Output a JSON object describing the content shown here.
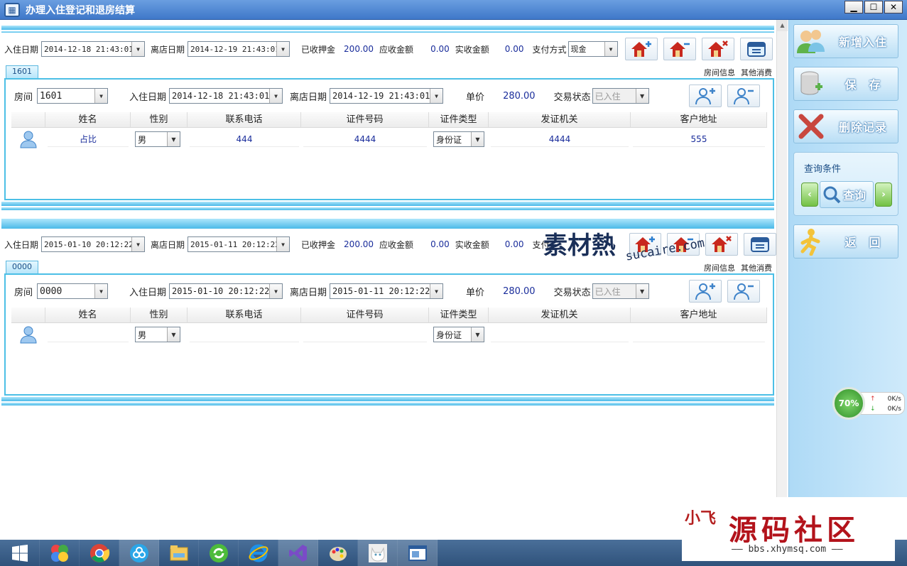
{
  "window": {
    "title": "办理入住登记和退房结算",
    "app_icon": "calendar-app-icon",
    "controls": {
      "minimize": "▁",
      "maximize": "☐",
      "close": "✕"
    }
  },
  "records": [
    {
      "top": {
        "checkin_label": "入住日期",
        "checkin_value": "2014-12-18 21:43:01",
        "checkout_label": "离店日期",
        "checkout_value": "2014-12-19 21:43:01",
        "deposit_label": "已收押金",
        "deposit_value": "200.00",
        "due_label": "应收金额",
        "due_value": "0.00",
        "paid_label": "实收金额",
        "paid_value": "0.00",
        "pay_label": "支付方式",
        "pay_value": "现金"
      },
      "tab": "1601",
      "tab_links": [
        "房间信息",
        "其他消费"
      ],
      "room": {
        "room_label": "房间",
        "room_value": "1601",
        "checkin_label": "入住日期",
        "checkin_value": "2014-12-18 21:43:01",
        "checkout_label": "离店日期",
        "checkout_value": "2014-12-19 21:43:01",
        "price_label": "单价",
        "price_value": "280.00",
        "status_label": "交易状态",
        "status_value": "已入住"
      },
      "guest": {
        "name": "占比",
        "gender": "男",
        "phone": "444",
        "id_number": "4444",
        "id_type": "身份证",
        "authority": "4444",
        "address": "555"
      }
    },
    {
      "top": {
        "checkin_label": "入住日期",
        "checkin_value": "2015-01-10 20:12:22",
        "checkout_label": "离店日期",
        "checkout_value": "2015-01-11 20:12:22",
        "deposit_label": "已收押金",
        "deposit_value": "200.00",
        "due_label": "应收金额",
        "due_value": "0.00",
        "paid_label": "实收金额",
        "paid_value": "0.00",
        "pay_label": "支付",
        "pay_value": ""
      },
      "tab": "0000",
      "tab_links": [
        "房间信息",
        "其他消费"
      ],
      "room": {
        "room_label": "房间",
        "room_value": "0000",
        "checkin_label": "入住日期",
        "checkin_value": "2015-01-10 20:12:22",
        "checkout_label": "离店日期",
        "checkout_value": "2015-01-11 20:12:22",
        "price_label": "单价",
        "price_value": "280.00",
        "status_label": "交易状态",
        "status_value": "已入住"
      },
      "guest": {
        "name": "",
        "gender": "男",
        "phone": "",
        "id_number": "",
        "id_type": "身份证",
        "authority": "",
        "address": ""
      }
    }
  ],
  "grid_columns": [
    "姓名",
    "性别",
    "联系电话",
    "证件号码",
    "证件类型",
    "发证机关",
    "客户地址"
  ],
  "sidebar": {
    "new_checkin": "新增入住",
    "save": "保　存",
    "delete": "删除记录",
    "query_label": "查询条件",
    "query_button": "查询",
    "back": "返　回"
  },
  "net_widget": {
    "percent": "70%",
    "up": "0K/s",
    "down": "0K/s"
  },
  "watermarks": {
    "sucai_big": "素材熱",
    "sucai_small": "sucaire.com",
    "forum_seal": "小飞",
    "forum_name": "源码社区",
    "forum_url": "—— bbs.xhymsq.com ——"
  },
  "taskbar": {
    "items": [
      "windows-start-icon",
      "color-balls-icon",
      "chrome-icon",
      "cloud-icon",
      "file-explorer-icon",
      "green-refresh-icon",
      "internet-explorer-icon",
      "visual-studio-icon",
      "paint-palette-icon",
      "cat-avatar-icon",
      "app-window-icon"
    ]
  },
  "colors": {
    "accent": "#4cbfe6",
    "value_text": "#1a2d9b",
    "title_bar": "#3f78c9"
  }
}
